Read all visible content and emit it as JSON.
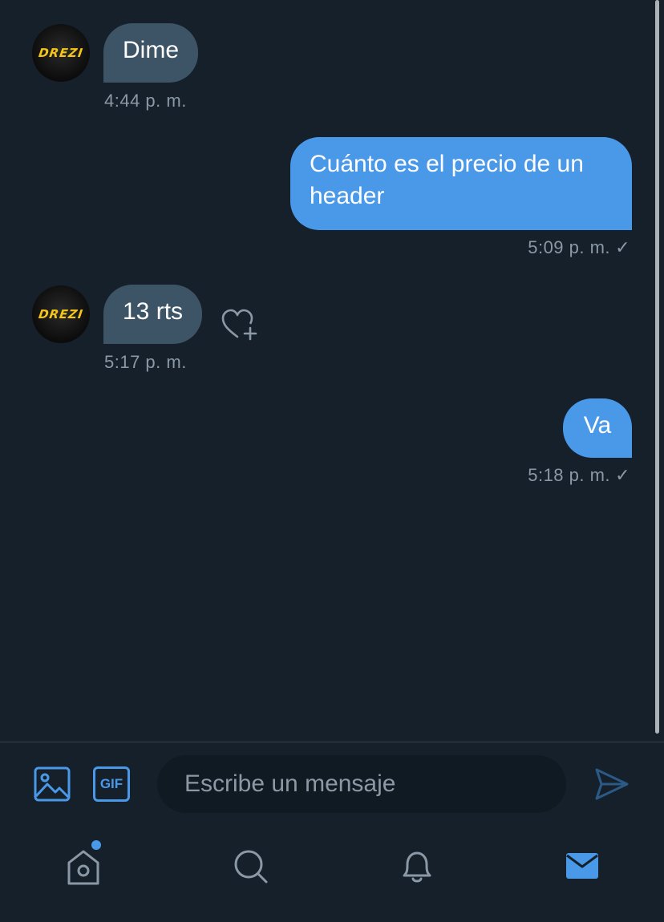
{
  "conversation": {
    "avatar_text": "DREZI",
    "messages": [
      {
        "direction": "incoming",
        "text": "Dime",
        "time": "4:44 p. m."
      },
      {
        "direction": "outgoing",
        "text": "Cuánto es el precio de un header",
        "time": "5:09 p. m."
      },
      {
        "direction": "incoming",
        "text": "13 rts",
        "time": "5:17 p. m."
      },
      {
        "direction": "outgoing",
        "text": "Va",
        "time": "5:18 p. m."
      }
    ],
    "read_mark": "✓"
  },
  "composer": {
    "placeholder": "Escribe un mensaje",
    "gif_label": "GIF",
    "icons": [
      "image-icon",
      "gif-icon",
      "send-icon"
    ]
  },
  "tabbar": {
    "items": [
      {
        "name": "home-icon",
        "active": false,
        "has_dot": true
      },
      {
        "name": "search-icon",
        "active": false
      },
      {
        "name": "notifications-icon",
        "active": false
      },
      {
        "name": "messages-icon",
        "active": true
      }
    ]
  },
  "colors": {
    "background": "#15202b",
    "incoming_bubble": "#3d5466",
    "outgoing_bubble": "#4a99e9",
    "accent": "#4a99e9",
    "muted_text": "#8b98a5"
  }
}
